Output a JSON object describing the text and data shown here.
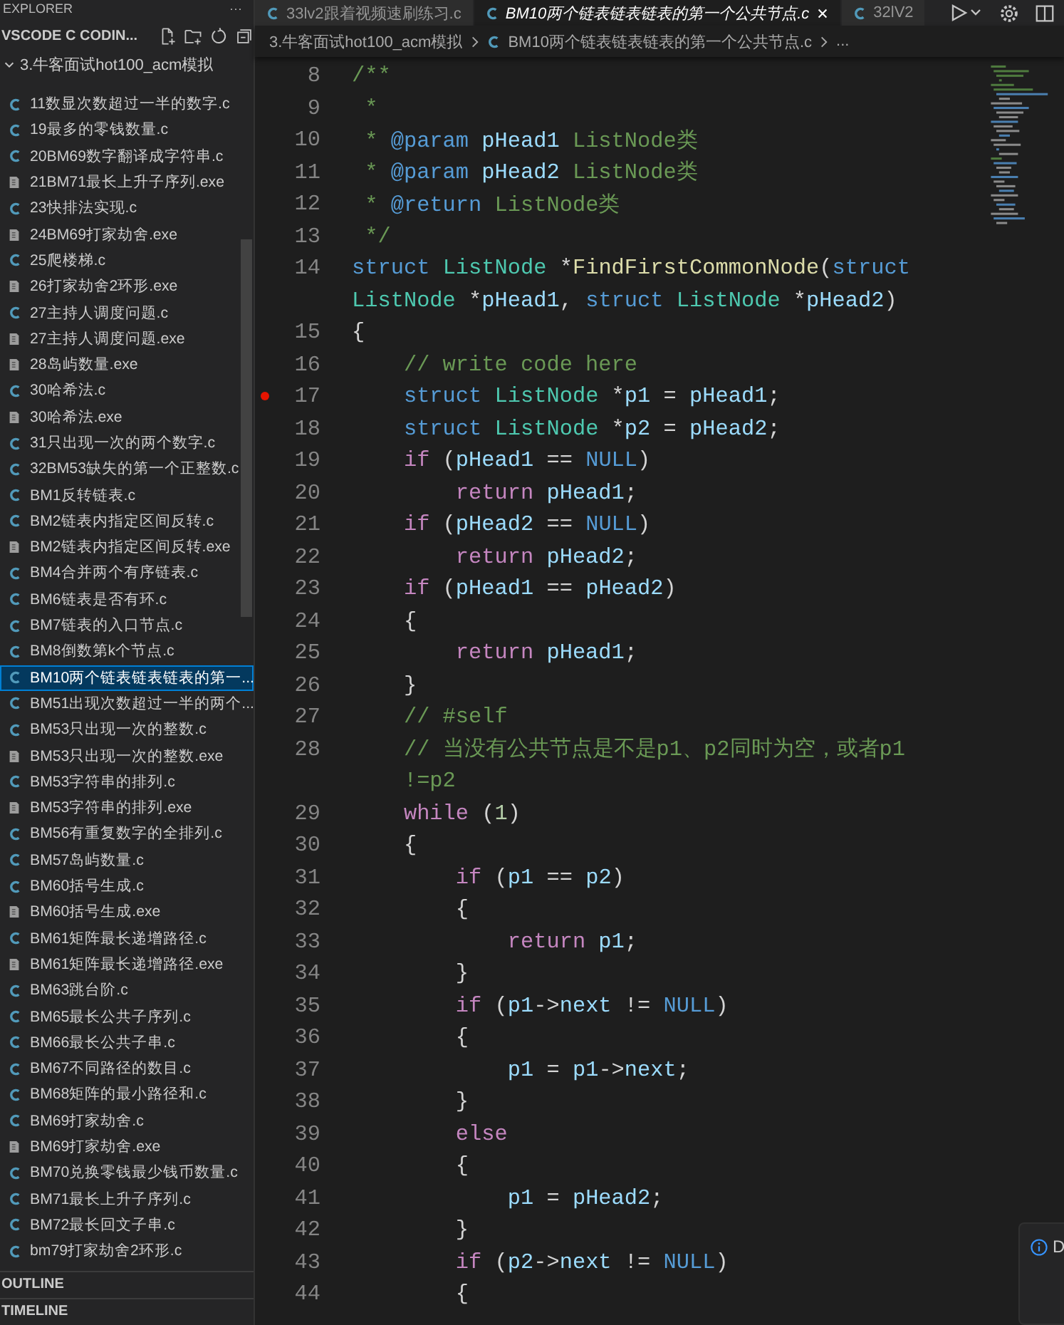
{
  "sidebar": {
    "title": "EXPLORER",
    "more": "···",
    "section": "VSCODE C CODIN...",
    "folder": {
      "label": "3.牛客面试hot100_acm模拟",
      "expanded": true
    },
    "items": [
      {
        "label": "11数显次数超过一半的数字.c",
        "kind": "c",
        "selected": false
      },
      {
        "label": "19最多的零钱数量.c",
        "kind": "c",
        "selected": false
      },
      {
        "label": "20BM69数字翻译成字符串.c",
        "kind": "c",
        "selected": false
      },
      {
        "label": "21BM71最长上升子序列.exe",
        "kind": "exe",
        "selected": false
      },
      {
        "label": "23快排法实现.c",
        "kind": "c",
        "selected": false
      },
      {
        "label": "24BM69打家劫舍.exe",
        "kind": "exe",
        "selected": false
      },
      {
        "label": "25爬楼梯.c",
        "kind": "c",
        "selected": false
      },
      {
        "label": "26打家劫舍2环形.exe",
        "kind": "exe",
        "selected": false
      },
      {
        "label": "27主持人调度问题.c",
        "kind": "c",
        "selected": false
      },
      {
        "label": "27主持人调度问题.exe",
        "kind": "exe",
        "selected": false
      },
      {
        "label": "28岛屿数量.exe",
        "kind": "exe",
        "selected": false
      },
      {
        "label": "30哈希法.c",
        "kind": "c",
        "selected": false
      },
      {
        "label": "30哈希法.exe",
        "kind": "exe",
        "selected": false
      },
      {
        "label": "31只出现一次的两个数字.c",
        "kind": "c",
        "selected": false
      },
      {
        "label": "32BM53缺失的第一个正整数.c",
        "kind": "c",
        "selected": false
      },
      {
        "label": "BM1反转链表.c",
        "kind": "c",
        "selected": false
      },
      {
        "label": "BM2链表内指定区间反转.c",
        "kind": "c",
        "selected": false
      },
      {
        "label": "BM2链表内指定区间反转.exe",
        "kind": "exe",
        "selected": false
      },
      {
        "label": "BM4合并两个有序链表.c",
        "kind": "c",
        "selected": false
      },
      {
        "label": "BM6链表是否有环.c",
        "kind": "c",
        "selected": false
      },
      {
        "label": "BM7链表的入口节点.c",
        "kind": "c",
        "selected": false
      },
      {
        "label": "BM8倒数第k个节点.c",
        "kind": "c",
        "selected": false
      },
      {
        "label": "BM10两个链表链表链表的第一...",
        "kind": "c",
        "selected": true
      },
      {
        "label": "BM51出现次数超过一半的两个...",
        "kind": "c",
        "selected": false
      },
      {
        "label": "BM53只出现一次的整数.c",
        "kind": "c",
        "selected": false
      },
      {
        "label": "BM53只出现一次的整数.exe",
        "kind": "exe",
        "selected": false
      },
      {
        "label": "BM53字符串的排列.c",
        "kind": "c",
        "selected": false
      },
      {
        "label": "BM53字符串的排列.exe",
        "kind": "exe",
        "selected": false
      },
      {
        "label": "BM56有重复数字的全排列.c",
        "kind": "c",
        "selected": false
      },
      {
        "label": "BM57岛屿数量.c",
        "kind": "c",
        "selected": false
      },
      {
        "label": "BM60括号生成.c",
        "kind": "c",
        "selected": false
      },
      {
        "label": "BM60括号生成.exe",
        "kind": "exe",
        "selected": false
      },
      {
        "label": "BM61矩阵最长递增路径.c",
        "kind": "c",
        "selected": false
      },
      {
        "label": "BM61矩阵最长递增路径.exe",
        "kind": "exe",
        "selected": false
      },
      {
        "label": "BM63跳台阶.c",
        "kind": "c",
        "selected": false
      },
      {
        "label": "BM65最长公共子序列.c",
        "kind": "c",
        "selected": false
      },
      {
        "label": "BM66最长公共子串.c",
        "kind": "c",
        "selected": false
      },
      {
        "label": "BM67不同路径的数目.c",
        "kind": "c",
        "selected": false
      },
      {
        "label": "BM68矩阵的最小路径和.c",
        "kind": "c",
        "selected": false
      },
      {
        "label": "BM69打家劫舍.c",
        "kind": "c",
        "selected": false
      },
      {
        "label": "BM69打家劫舍.exe",
        "kind": "exe",
        "selected": false
      },
      {
        "label": "BM70兑换零钱最少钱币数量.c",
        "kind": "c",
        "selected": false
      },
      {
        "label": "BM71最长上升子序列.c",
        "kind": "c",
        "selected": false
      },
      {
        "label": "BM72最长回文子串.c",
        "kind": "c",
        "selected": false
      },
      {
        "label": "bm79打家劫舍2环形.c",
        "kind": "c",
        "selected": false
      }
    ],
    "panels": [
      {
        "label": "OUTLINE"
      },
      {
        "label": "TIMELINE"
      }
    ]
  },
  "tabs": [
    {
      "label": "33lv2跟着视频速刷练习.c",
      "selected": false
    },
    {
      "label": "BM10两个链表链表链表的第一个公共节点.c",
      "selected": true
    },
    {
      "label": "32lV2",
      "selected": false
    }
  ],
  "breadcrumb": {
    "folder": "3.牛客面试hot100_acm模拟",
    "file": "BM10两个链表链表链表的第一个公共节点.c",
    "more": "..."
  },
  "lines": [
    {
      "n": "8",
      "tokens": [
        {
          "kind": "cm",
          "text": "/**"
        }
      ]
    },
    {
      "n": "9",
      "tokens": [
        {
          "kind": "cm",
          "text": " *"
        }
      ]
    },
    {
      "n": "10",
      "tokens": [
        {
          "kind": "cm",
          "text": " * "
        },
        {
          "kind": "doc",
          "text": "@param"
        },
        {
          "kind": "var",
          "text": " pHead1"
        },
        {
          "kind": "cm",
          "text": " ListNode类"
        }
      ]
    },
    {
      "n": "11",
      "tokens": [
        {
          "kind": "cm",
          "text": " * "
        },
        {
          "kind": "doc",
          "text": "@param"
        },
        {
          "kind": "var",
          "text": " pHead2"
        },
        {
          "kind": "cm",
          "text": " ListNode类"
        }
      ]
    },
    {
      "n": "12",
      "tokens": [
        {
          "kind": "cm",
          "text": " * "
        },
        {
          "kind": "doc",
          "text": "@return"
        },
        {
          "kind": "cm",
          "text": " ListNode类"
        }
      ]
    },
    {
      "n": "13",
      "tokens": [
        {
          "kind": "cm",
          "text": " */"
        }
      ]
    },
    {
      "n": "14",
      "tokens": [
        {
          "kind": "kw",
          "text": "struct "
        },
        {
          "kind": "ty",
          "text": "ListNode"
        },
        {
          "kind": "op",
          "text": " *"
        },
        {
          "kind": "fn",
          "text": "FindFirstCommonNode"
        },
        {
          "kind": "op",
          "text": "("
        },
        {
          "kind": "kw",
          "text": "struct"
        }
      ],
      "wrap": [
        {
          "kind": "ty",
          "text": "ListNode"
        },
        {
          "kind": "op",
          "text": " *"
        },
        {
          "kind": "var",
          "text": "pHead1"
        },
        {
          "kind": "op",
          "text": ", "
        },
        {
          "kind": "kw",
          "text": "struct "
        },
        {
          "kind": "ty",
          "text": "ListNode"
        },
        {
          "kind": "op",
          "text": " *"
        },
        {
          "kind": "var",
          "text": "pHead2"
        },
        {
          "kind": "op",
          "text": ")"
        }
      ]
    },
    {
      "n": "15",
      "tokens": [
        {
          "kind": "op",
          "text": "{"
        }
      ]
    },
    {
      "n": "16",
      "tokens": [
        {
          "kind": "cm",
          "text": "    // write code here"
        }
      ]
    },
    {
      "n": "17",
      "breakpoint": true,
      "tokens": [
        {
          "kind": "kw",
          "text": "    struct "
        },
        {
          "kind": "ty",
          "text": "ListNode"
        },
        {
          "kind": "op",
          "text": " *"
        },
        {
          "kind": "var",
          "text": "p1"
        },
        {
          "kind": "op",
          "text": " = "
        },
        {
          "kind": "var",
          "text": "pHead1"
        },
        {
          "kind": "op",
          "text": ";"
        }
      ]
    },
    {
      "n": "18",
      "tokens": [
        {
          "kind": "kw",
          "text": "    struct "
        },
        {
          "kind": "ty",
          "text": "ListNode"
        },
        {
          "kind": "op",
          "text": " *"
        },
        {
          "kind": "var",
          "text": "p2"
        },
        {
          "kind": "op",
          "text": " = "
        },
        {
          "kind": "var",
          "text": "pHead2"
        },
        {
          "kind": "op",
          "text": ";"
        }
      ]
    },
    {
      "n": "19",
      "tokens": [
        {
          "kind": "ctl",
          "text": "    if"
        },
        {
          "kind": "op",
          "text": " ("
        },
        {
          "kind": "var",
          "text": "pHead1"
        },
        {
          "kind": "op",
          "text": " == "
        },
        {
          "kind": "kw",
          "text": "NULL"
        },
        {
          "kind": "op",
          "text": ")"
        }
      ]
    },
    {
      "n": "20",
      "tokens": [
        {
          "kind": "ctl",
          "text": "        return "
        },
        {
          "kind": "var",
          "text": "pHead1"
        },
        {
          "kind": "op",
          "text": ";"
        }
      ]
    },
    {
      "n": "21",
      "tokens": [
        {
          "kind": "ctl",
          "text": "    if"
        },
        {
          "kind": "op",
          "text": " ("
        },
        {
          "kind": "var",
          "text": "pHead2"
        },
        {
          "kind": "op",
          "text": " == "
        },
        {
          "kind": "kw",
          "text": "NULL"
        },
        {
          "kind": "op",
          "text": ")"
        }
      ]
    },
    {
      "n": "22",
      "tokens": [
        {
          "kind": "ctl",
          "text": "        return "
        },
        {
          "kind": "var",
          "text": "pHead2"
        },
        {
          "kind": "op",
          "text": ";"
        }
      ]
    },
    {
      "n": "23",
      "tokens": [
        {
          "kind": "ctl",
          "text": "    if"
        },
        {
          "kind": "op",
          "text": " ("
        },
        {
          "kind": "var",
          "text": "pHead1"
        },
        {
          "kind": "op",
          "text": " == "
        },
        {
          "kind": "var",
          "text": "pHead2"
        },
        {
          "kind": "op",
          "text": ")"
        }
      ]
    },
    {
      "n": "24",
      "tokens": [
        {
          "kind": "op",
          "text": "    {"
        }
      ]
    },
    {
      "n": "25",
      "tokens": [
        {
          "kind": "ctl",
          "text": "        return "
        },
        {
          "kind": "var",
          "text": "pHead1"
        },
        {
          "kind": "op",
          "text": ";"
        }
      ]
    },
    {
      "n": "26",
      "tokens": [
        {
          "kind": "op",
          "text": "    }"
        }
      ]
    },
    {
      "n": "27",
      "tokens": [
        {
          "kind": "cm",
          "text": "    // #self"
        }
      ]
    },
    {
      "n": "28",
      "tokens": [
        {
          "kind": "cm",
          "text": "    // 当没有公共节点是不是p1、p2同时为空，或者p1"
        }
      ],
      "wrap": [
        {
          "kind": "cm",
          "text": "    !=p2"
        }
      ]
    },
    {
      "n": "29",
      "tokens": [
        {
          "kind": "ctl",
          "text": "    while"
        },
        {
          "kind": "op",
          "text": " ("
        },
        {
          "kind": "num",
          "text": "1"
        },
        {
          "kind": "op",
          "text": ")"
        }
      ]
    },
    {
      "n": "30",
      "tokens": [
        {
          "kind": "op",
          "text": "    {"
        }
      ]
    },
    {
      "n": "31",
      "tokens": [
        {
          "kind": "ctl",
          "text": "        if"
        },
        {
          "kind": "op",
          "text": " ("
        },
        {
          "kind": "var",
          "text": "p1"
        },
        {
          "kind": "op",
          "text": " == "
        },
        {
          "kind": "var",
          "text": "p2"
        },
        {
          "kind": "op",
          "text": ")"
        }
      ]
    },
    {
      "n": "32",
      "tokens": [
        {
          "kind": "op",
          "text": "        {"
        }
      ]
    },
    {
      "n": "33",
      "tokens": [
        {
          "kind": "ctl",
          "text": "            return "
        },
        {
          "kind": "var",
          "text": "p1"
        },
        {
          "kind": "op",
          "text": ";"
        }
      ]
    },
    {
      "n": "34",
      "tokens": [
        {
          "kind": "op",
          "text": "        }"
        }
      ]
    },
    {
      "n": "35",
      "tokens": [
        {
          "kind": "ctl",
          "text": "        if"
        },
        {
          "kind": "op",
          "text": " ("
        },
        {
          "kind": "var",
          "text": "p1"
        },
        {
          "kind": "op",
          "text": "->"
        },
        {
          "kind": "var",
          "text": "next"
        },
        {
          "kind": "op",
          "text": " != "
        },
        {
          "kind": "kw",
          "text": "NULL"
        },
        {
          "kind": "op",
          "text": ")"
        }
      ]
    },
    {
      "n": "36",
      "tokens": [
        {
          "kind": "op",
          "text": "        {"
        }
      ]
    },
    {
      "n": "37",
      "tokens": [
        {
          "kind": "var",
          "text": "            p1"
        },
        {
          "kind": "op",
          "text": " = "
        },
        {
          "kind": "var",
          "text": "p1"
        },
        {
          "kind": "op",
          "text": "->"
        },
        {
          "kind": "var",
          "text": "next"
        },
        {
          "kind": "op",
          "text": ";"
        }
      ]
    },
    {
      "n": "38",
      "tokens": [
        {
          "kind": "op",
          "text": "        }"
        }
      ]
    },
    {
      "n": "39",
      "tokens": [
        {
          "kind": "ctl",
          "text": "        else"
        }
      ]
    },
    {
      "n": "40",
      "tokens": [
        {
          "kind": "op",
          "text": "        {"
        }
      ]
    },
    {
      "n": "41",
      "tokens": [
        {
          "kind": "var",
          "text": "            p1"
        },
        {
          "kind": "op",
          "text": " = "
        },
        {
          "kind": "var",
          "text": "pHead2"
        },
        {
          "kind": "op",
          "text": ";"
        }
      ]
    },
    {
      "n": "42",
      "tokens": [
        {
          "kind": "op",
          "text": "        }"
        }
      ]
    },
    {
      "n": "43",
      "tokens": [
        {
          "kind": "ctl",
          "text": "        if"
        },
        {
          "kind": "op",
          "text": " ("
        },
        {
          "kind": "var",
          "text": "p2"
        },
        {
          "kind": "op",
          "text": "->"
        },
        {
          "kind": "var",
          "text": "next"
        },
        {
          "kind": "op",
          "text": " != "
        },
        {
          "kind": "kw",
          "text": "NULL"
        },
        {
          "kind": "op",
          "text": ")"
        }
      ]
    },
    {
      "n": "44",
      "tokens": [
        {
          "kind": "op",
          "text": "        {"
        }
      ]
    }
  ],
  "notification": {
    "text": "D"
  }
}
